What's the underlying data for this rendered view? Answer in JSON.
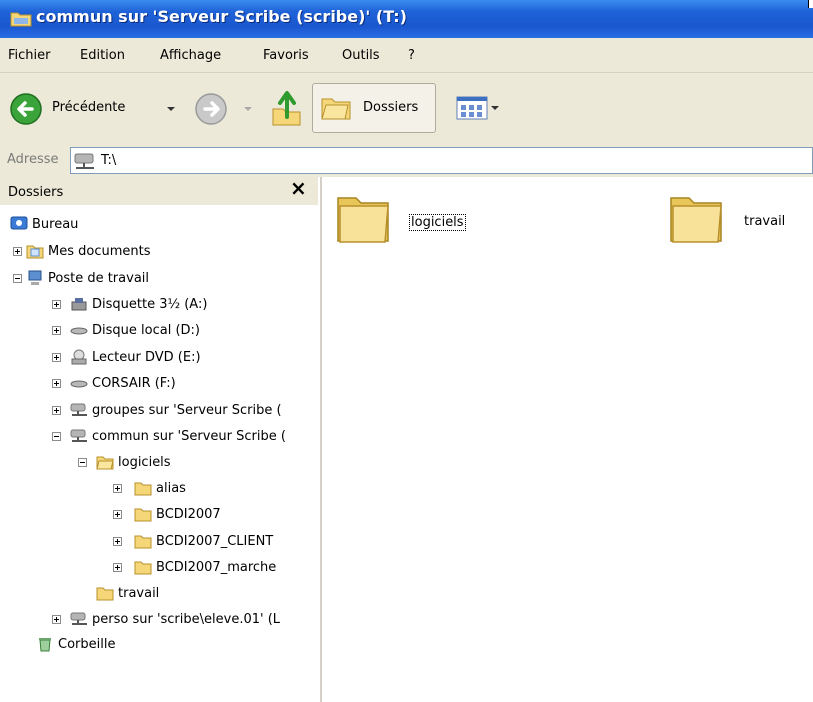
{
  "window": {
    "title": "commun sur 'Serveur Scribe (scribe)' (T:)"
  },
  "menu": [
    "Fichier",
    "Edition",
    "Affichage",
    "Favoris",
    "Outils",
    "?"
  ],
  "toolbar": {
    "back_label": "Précédente",
    "folders_label": "Dossiers"
  },
  "address": {
    "label": "Adresse",
    "value": "T:\\"
  },
  "folders_pane": {
    "title": "Dossiers",
    "close_glyph": "×",
    "tree": [
      {
        "label": "Bureau",
        "icon": "desktop-icon"
      },
      {
        "label": "Mes documents",
        "icon": "my-documents-icon"
      },
      {
        "label": "Poste de travail",
        "icon": "my-computer-icon"
      },
      {
        "label": "Disquette 3½ (A:)",
        "icon": "floppy-drive-icon"
      },
      {
        "label": "Disque local (D:)",
        "icon": "hard-drive-icon"
      },
      {
        "label": "Lecteur DVD (E:)",
        "icon": "dvd-drive-icon"
      },
      {
        "label": "CORSAIR (F:)",
        "icon": "removable-drive-icon"
      },
      {
        "label": "groupes sur 'Serveur Scribe (",
        "icon": "network-drive-icon"
      },
      {
        "label": "commun sur 'Serveur Scribe (",
        "icon": "network-drive-icon"
      },
      {
        "label": "logiciels",
        "icon": "folder-open-icon"
      },
      {
        "label": "alias",
        "icon": "folder-icon"
      },
      {
        "label": "BCDI2007",
        "icon": "folder-icon"
      },
      {
        "label": "BCDI2007_CLIENT",
        "icon": "folder-icon"
      },
      {
        "label": "BCDI2007_marche",
        "icon": "folder-icon"
      },
      {
        "label": "travail",
        "icon": "folder-icon"
      },
      {
        "label": "perso sur 'scribe\\eleve.01' (L",
        "icon": "network-drive-icon"
      },
      {
        "label": "Corbeille",
        "icon": "recycle-bin-icon"
      }
    ]
  },
  "content": {
    "items": [
      {
        "label": "logiciels",
        "icon": "folder-icon"
      },
      {
        "label": "travail",
        "icon": "folder-icon"
      }
    ]
  },
  "colors": {
    "titlebar": "#1f5fd6",
    "chrome": "#ece9d8",
    "folder": "#f5d77a"
  }
}
